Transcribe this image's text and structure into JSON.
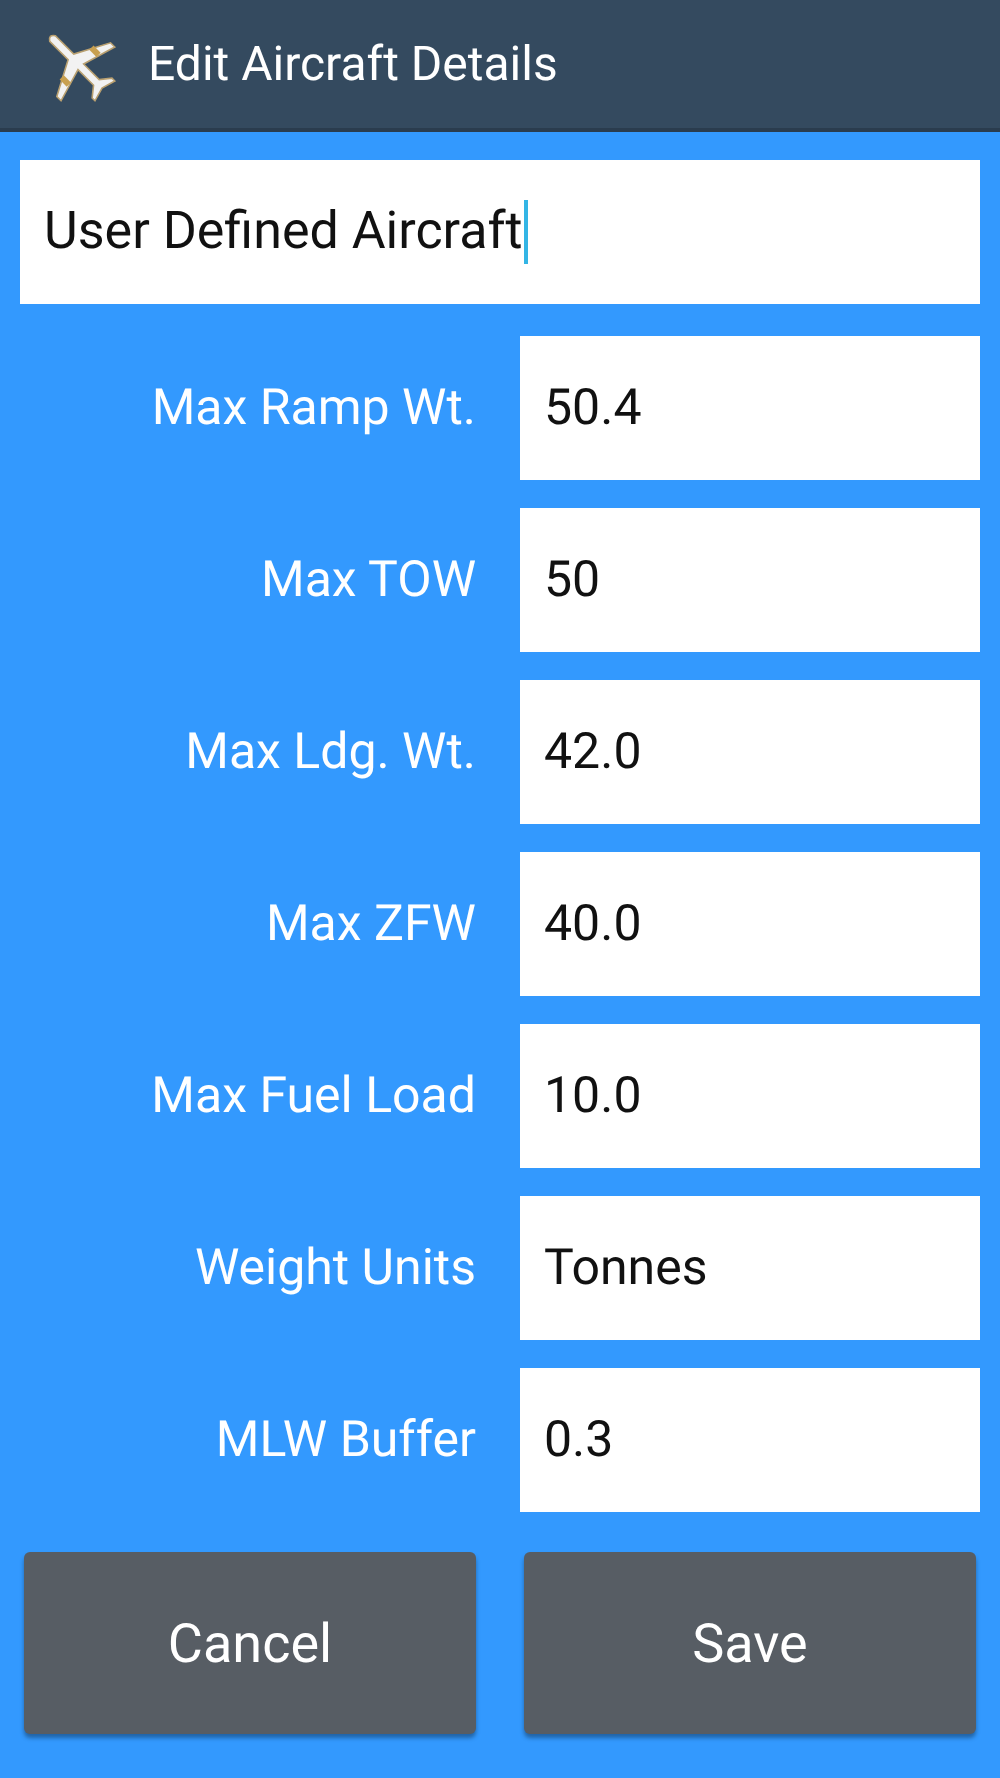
{
  "title": "Edit Aircraft Details",
  "name_field": {
    "value": "User Defined Aircraft",
    "focused": true
  },
  "fields": [
    {
      "label": "Max Ramp Wt.",
      "value": "50.4"
    },
    {
      "label": "Max TOW",
      "value": "50"
    },
    {
      "label": "Max Ldg. Wt.",
      "value": "42.0"
    },
    {
      "label": "Max ZFW",
      "value": "40.0"
    },
    {
      "label": "Max Fuel Load",
      "value": "10.0"
    },
    {
      "label": "Weight Units",
      "value": "Tonnes"
    },
    {
      "label": "MLW Buffer",
      "value": "0.3"
    }
  ],
  "buttons": [
    "Cancel",
    "Save"
  ]
}
